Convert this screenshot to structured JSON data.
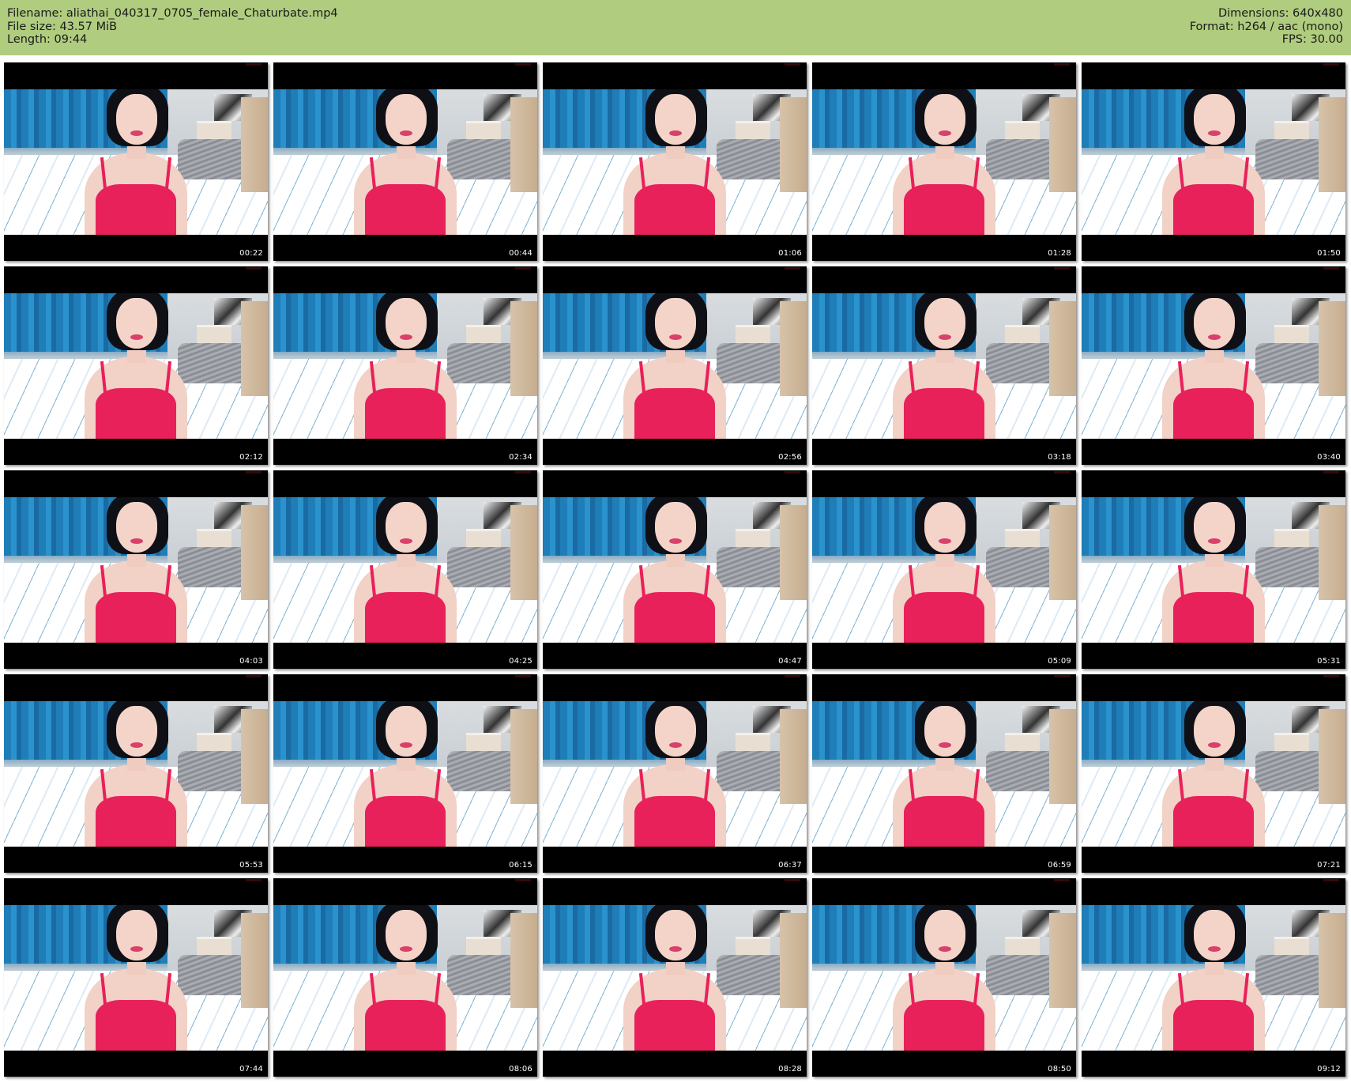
{
  "header": {
    "filename_label": "Filename: aliathai_040317_0705_female_Chaturbate.mp4",
    "filesize_label": "File size: 43.57 MiB",
    "length_label": "Length: 09:44",
    "dimensions_label": "Dimensions: 640x480",
    "format_label": "Format: h264 / aac (mono)",
    "fps_label": "FPS: 30.00",
    "background_color": "#b0cc7f"
  },
  "thumbnails": [
    {
      "time": "00:22"
    },
    {
      "time": "00:44"
    },
    {
      "time": "01:06"
    },
    {
      "time": "01:28"
    },
    {
      "time": "01:50"
    },
    {
      "time": "02:12"
    },
    {
      "time": "02:34"
    },
    {
      "time": "02:56"
    },
    {
      "time": "03:18"
    },
    {
      "time": "03:40"
    },
    {
      "time": "04:03"
    },
    {
      "time": "04:25"
    },
    {
      "time": "04:47"
    },
    {
      "time": "05:09"
    },
    {
      "time": "05:31"
    },
    {
      "time": "05:53"
    },
    {
      "time": "06:15"
    },
    {
      "time": "06:37"
    },
    {
      "time": "06:59"
    },
    {
      "time": "07:21"
    },
    {
      "time": "07:44"
    },
    {
      "time": "08:06"
    },
    {
      "time": "08:28"
    },
    {
      "time": "08:50"
    },
    {
      "time": "09:12"
    }
  ]
}
